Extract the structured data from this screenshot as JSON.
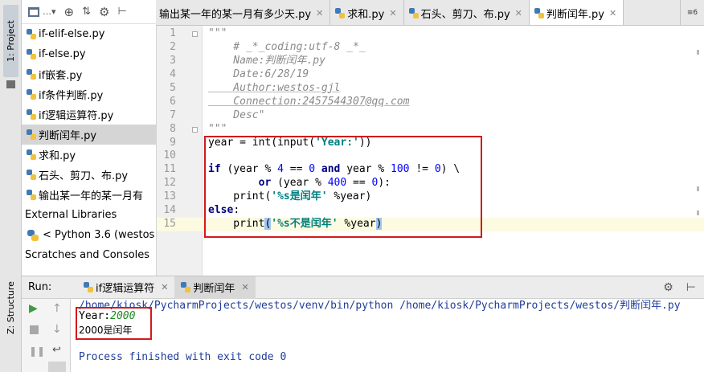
{
  "side_strip": {
    "project_label": "1: Project",
    "structure_label": "Z: Structure"
  },
  "project_panel": {
    "toolbar_icons": [
      "project-view-icon",
      "dropdown-icon",
      "locate-icon",
      "collapse-icon",
      "settings-icon",
      "hide-icon"
    ],
    "files": [
      {
        "name": "if-elif-else.py",
        "selected": false
      },
      {
        "name": "if-else.py",
        "selected": false
      },
      {
        "name": "if嵌套.py",
        "selected": false
      },
      {
        "name": "if条件判断.py",
        "selected": false
      },
      {
        "name": "if逻辑运算符.py",
        "selected": false
      },
      {
        "name": "判断闰年.py",
        "selected": true
      },
      {
        "name": "求和.py",
        "selected": false
      },
      {
        "name": "石头、剪刀、布.py",
        "selected": false
      },
      {
        "name": "输出某一年的某一月有",
        "selected": false
      }
    ],
    "external_libraries": "External Libraries",
    "python_sdk": "< Python 3.6 (westos",
    "scratches": "Scratches and Consoles"
  },
  "editor_tabs": {
    "tabs": [
      {
        "label": "输出某一年的某一月有多少天.py",
        "active": false
      },
      {
        "label": "求和.py",
        "active": false
      },
      {
        "label": "石头、剪刀、布.py",
        "active": false
      },
      {
        "label": "判断闰年.py",
        "active": true
      }
    ],
    "more_label": "≡6"
  },
  "editor": {
    "lines": [
      {
        "n": "1",
        "text": "\"\"\""
      },
      {
        "n": "2",
        "text": "    # _*_coding:utf-8 _*_"
      },
      {
        "n": "3",
        "text": "    Name:判断闰年.py"
      },
      {
        "n": "4",
        "text": "    Date:6/28/19"
      },
      {
        "n": "5",
        "text": "    Author:westos-gjl"
      },
      {
        "n": "6",
        "text": "    Connection:2457544307@qq.com"
      },
      {
        "n": "7",
        "text": "    Desc\""
      },
      {
        "n": "8",
        "text": "\"\"\""
      },
      {
        "n": "9",
        "text": "year = int(input('Year:'))"
      },
      {
        "n": "10",
        "text": ""
      },
      {
        "n": "11",
        "text": "if (year % 4 == 0 and year % 100 != 0) \\"
      },
      {
        "n": "12",
        "text": "        or (year % 400 == 0):"
      },
      {
        "n": "13",
        "text": "    print('%s是闰年' %year)"
      },
      {
        "n": "14",
        "text": "else:"
      },
      {
        "n": "15",
        "text": "    print('%s不是闰年' %year)"
      }
    ],
    "current_line": 15
  },
  "run_panel": {
    "label": "Run:",
    "tabs": [
      {
        "label": "if逻辑运算符",
        "active": false
      },
      {
        "label": "判断闰年",
        "active": true
      }
    ],
    "console": {
      "command": "/home/kiosk/PycharmProjects/westos/venv/bin/python /home/kiosk/PycharmProjects/westos/判断闰年.py",
      "prompt": "Year:",
      "input_value": "2000",
      "output": "2000是闰年",
      "exit_message": "Process finished with exit code 0"
    }
  }
}
